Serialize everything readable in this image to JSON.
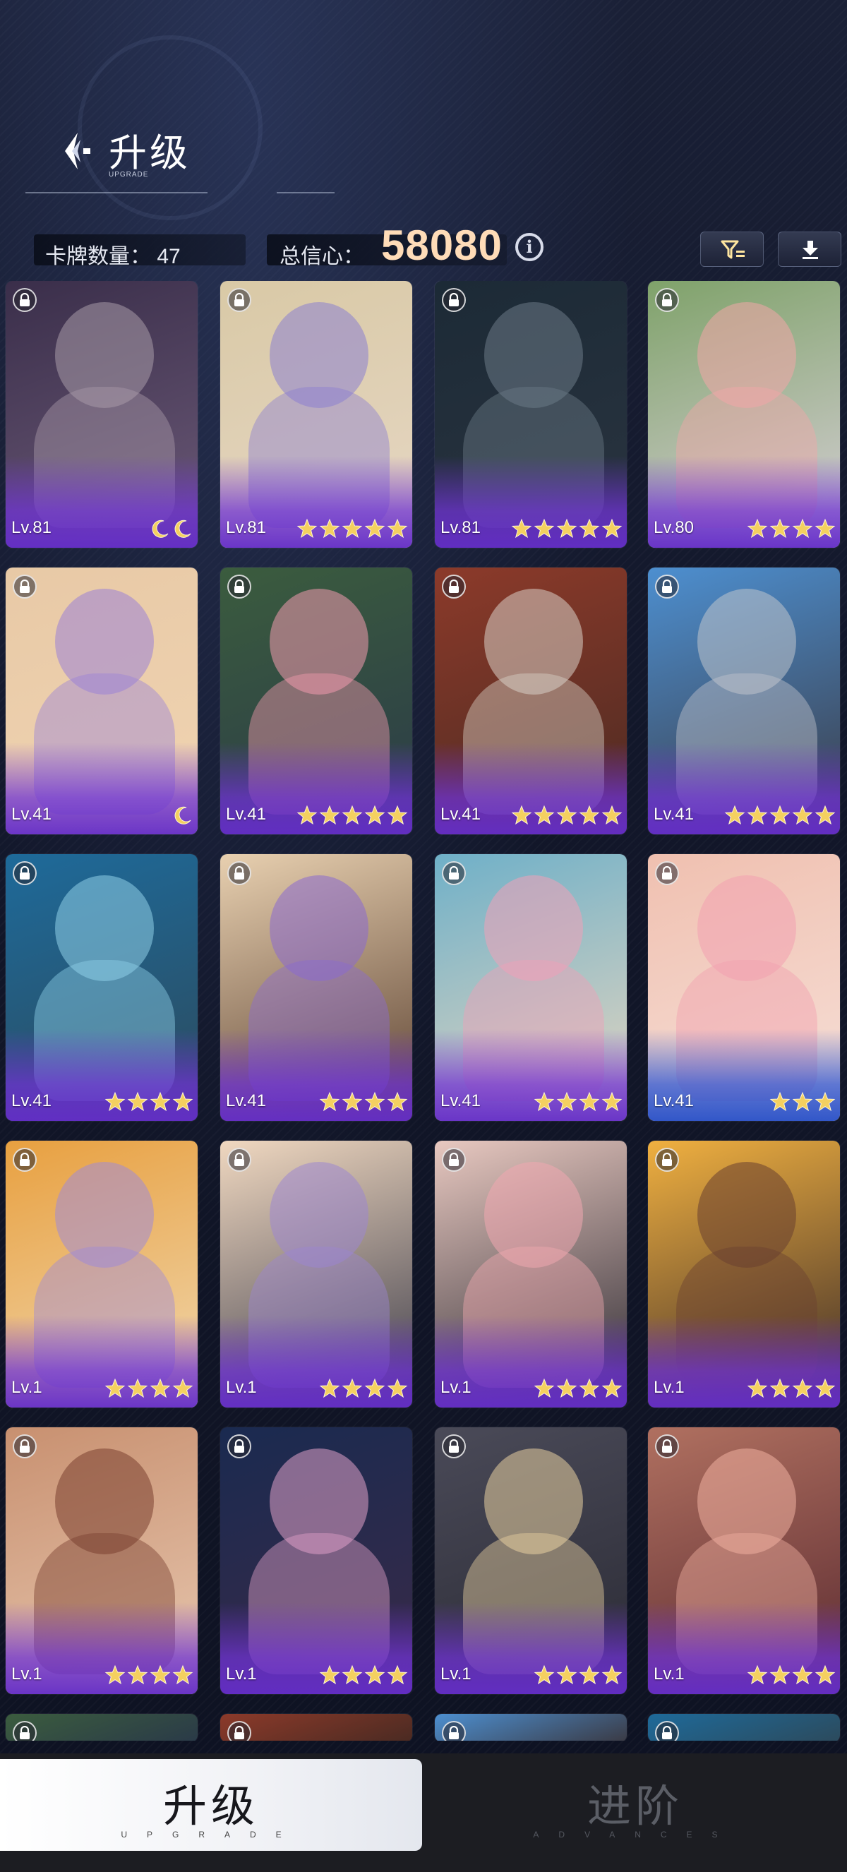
{
  "header": {
    "title": "升级",
    "subtitle": "UPGRADE",
    "card_count_label": "卡牌数量：",
    "card_count": "47",
    "confidence_label": "总信心：",
    "confidence_value": "58080"
  },
  "toolbar": {
    "info_icon": "info-icon",
    "filter_icon": "filter-icon",
    "download_icon": "download-icon"
  },
  "colors": {
    "accent_purple": "#6f34d2",
    "accent_blue": "#2f56cc",
    "star_gold": "#f4d060",
    "confidence_text": "#ffdcb8"
  },
  "cards": [
    {
      "level": "Lv.81",
      "rank_icon": "moon",
      "rank": 2,
      "tint": "purple"
    },
    {
      "level": "Lv.81",
      "rank_icon": "star",
      "rank": 5,
      "tint": "purple"
    },
    {
      "level": "Lv.81",
      "rank_icon": "star",
      "rank": 5,
      "tint": "purple"
    },
    {
      "level": "Lv.80",
      "rank_icon": "star",
      "rank": 4,
      "tint": "purple"
    },
    {
      "level": "Lv.41",
      "rank_icon": "moon",
      "rank": 1,
      "tint": "purple"
    },
    {
      "level": "Lv.41",
      "rank_icon": "star",
      "rank": 5,
      "tint": "purple"
    },
    {
      "level": "Lv.41",
      "rank_icon": "star",
      "rank": 5,
      "tint": "purple"
    },
    {
      "level": "Lv.41",
      "rank_icon": "star",
      "rank": 5,
      "tint": "purple"
    },
    {
      "level": "Lv.41",
      "rank_icon": "star",
      "rank": 4,
      "tint": "purple"
    },
    {
      "level": "Lv.41",
      "rank_icon": "star",
      "rank": 4,
      "tint": "purple"
    },
    {
      "level": "Lv.41",
      "rank_icon": "star",
      "rank": 4,
      "tint": "purple"
    },
    {
      "level": "Lv.41",
      "rank_icon": "star",
      "rank": 3,
      "tint": "blue"
    },
    {
      "level": "Lv.1",
      "rank_icon": "star",
      "rank": 4,
      "tint": "purple"
    },
    {
      "level": "Lv.1",
      "rank_icon": "star",
      "rank": 4,
      "tint": "purple"
    },
    {
      "level": "Lv.1",
      "rank_icon": "star",
      "rank": 4,
      "tint": "purple"
    },
    {
      "level": "Lv.1",
      "rank_icon": "star",
      "rank": 4,
      "tint": "purple"
    },
    {
      "level": "Lv.1",
      "rank_icon": "star",
      "rank": 4,
      "tint": "purple"
    },
    {
      "level": "Lv.1",
      "rank_icon": "star",
      "rank": 4,
      "tint": "purple"
    },
    {
      "level": "Lv.1",
      "rank_icon": "star",
      "rank": 4,
      "tint": "purple"
    },
    {
      "level": "Lv.1",
      "rank_icon": "star",
      "rank": 4,
      "tint": "purple"
    }
  ],
  "tabs": {
    "upgrade_label": "升级",
    "upgrade_sub": "UPGRADE",
    "advance_label": "进阶",
    "advance_sub": "ADVANCES"
  }
}
